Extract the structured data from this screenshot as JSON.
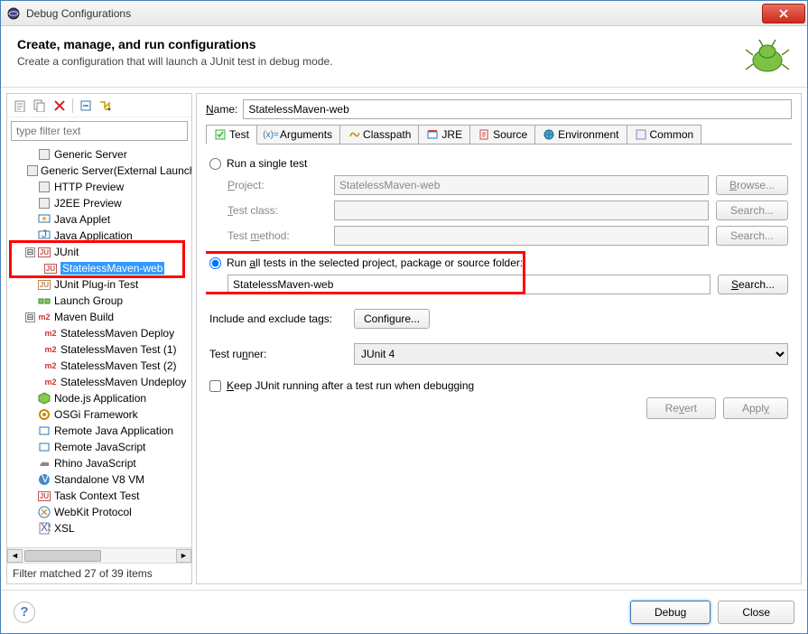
{
  "window": {
    "title": "Debug Configurations"
  },
  "header": {
    "title": "Create, manage, and run configurations",
    "subtitle": "Create a configuration that will launch a JUnit test in debug mode."
  },
  "filter": {
    "placeholder": "type filter text"
  },
  "tree": {
    "items": [
      {
        "label": "Generic Server",
        "icon": "server",
        "depth": 1
      },
      {
        "label": "Generic Server(External Launch)",
        "icon": "server",
        "depth": 1
      },
      {
        "label": "HTTP Preview",
        "icon": "server",
        "depth": 1
      },
      {
        "label": "J2EE Preview",
        "icon": "server",
        "depth": 1
      },
      {
        "label": "Java Applet",
        "icon": "applet",
        "depth": 1
      },
      {
        "label": "Java Application",
        "icon": "javaapp",
        "depth": 1
      },
      {
        "label": "JUnit",
        "icon": "ju",
        "depth": 1,
        "expander": "-"
      },
      {
        "label": "StatelessMaven-web",
        "icon": "ju",
        "depth": 2,
        "selected": true
      },
      {
        "label": "JUnit Plug-in Test",
        "icon": "ju-plugin",
        "depth": 1
      },
      {
        "label": "Launch Group",
        "icon": "launchgroup",
        "depth": 1
      },
      {
        "label": "Maven Build",
        "icon": "m2",
        "depth": 1,
        "expander": "-"
      },
      {
        "label": "StatelessMaven Deploy",
        "icon": "m2",
        "depth": 2
      },
      {
        "label": "StatelessMaven Test (1)",
        "icon": "m2",
        "depth": 2
      },
      {
        "label": "StatelessMaven Test (2)",
        "icon": "m2",
        "depth": 2
      },
      {
        "label": "StatelessMaven Undeploy",
        "icon": "m2",
        "depth": 2
      },
      {
        "label": "Node.js Application",
        "icon": "node",
        "depth": 1
      },
      {
        "label": "OSGi Framework",
        "icon": "osgi",
        "depth": 1
      },
      {
        "label": "Remote Java Application",
        "icon": "remotejava",
        "depth": 1
      },
      {
        "label": "Remote JavaScript",
        "icon": "remotejs",
        "depth": 1
      },
      {
        "label": "Rhino JavaScript",
        "icon": "rhino",
        "depth": 1
      },
      {
        "label": "Standalone V8 VM",
        "icon": "v8",
        "depth": 1
      },
      {
        "label": "Task Context Test",
        "icon": "ju",
        "depth": 1
      },
      {
        "label": "WebKit Protocol",
        "icon": "webkit",
        "depth": 1
      },
      {
        "label": "XSL",
        "icon": "xsl",
        "depth": 1
      }
    ]
  },
  "filterStatus": "Filter matched 27 of 39 items",
  "name": {
    "label": "Name:",
    "value": "StatelessMaven-web"
  },
  "tabs": [
    {
      "label": "Test",
      "active": true
    },
    {
      "label": "Arguments",
      "active": false
    },
    {
      "label": "Classpath",
      "active": false
    },
    {
      "label": "JRE",
      "active": false
    },
    {
      "label": "Source",
      "active": false
    },
    {
      "label": "Environment",
      "active": false
    },
    {
      "label": "Common",
      "active": false
    }
  ],
  "test": {
    "runSingle": {
      "label": "Run a single test"
    },
    "project": {
      "label": "Project:",
      "value": "StatelessMaven-web",
      "button": "Browse..."
    },
    "testClass": {
      "label": "Test class:",
      "value": "",
      "button": "Search..."
    },
    "testMethod": {
      "label": "Test method:",
      "value": "",
      "button": "Search..."
    },
    "runAll": {
      "label": "Run all tests in the selected project, package or source folder:"
    },
    "selectedPath": {
      "value": "StatelessMaven-web",
      "button": "Search..."
    },
    "includeExclude": {
      "label": "Include and exclude tags:",
      "button": "Configure..."
    },
    "testRunner": {
      "label": "Test runner:",
      "value": "JUnit 4"
    },
    "keepRunning": {
      "label": "Keep JUnit running after a test run when debugging"
    }
  },
  "rightButtons": {
    "revert": "Revert",
    "apply": "Apply"
  },
  "footer": {
    "debug": "Debug",
    "close": "Close"
  }
}
